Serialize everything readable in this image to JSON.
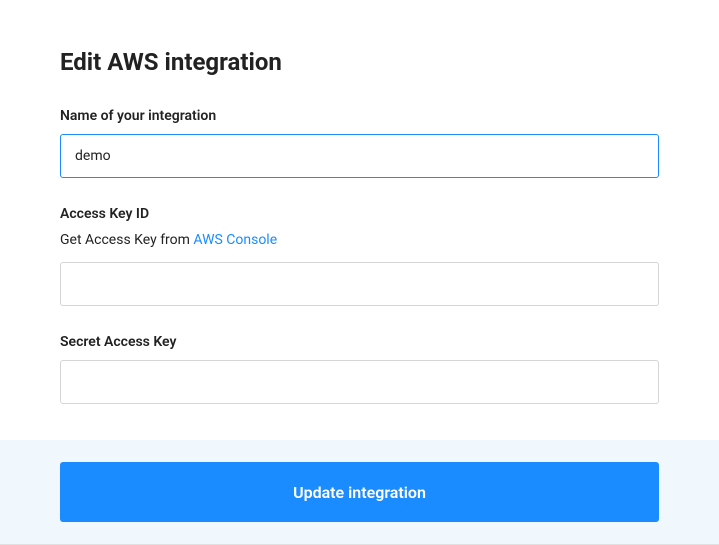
{
  "page": {
    "title": "Edit AWS integration"
  },
  "form": {
    "name": {
      "label": "Name of your integration",
      "value": "demo"
    },
    "accessKeyId": {
      "label": "Access Key ID",
      "help_prefix": "Get Access Key from ",
      "help_link_text": "AWS Console",
      "value": ""
    },
    "secretAccessKey": {
      "label": "Secret Access Key",
      "value": ""
    }
  },
  "footer": {
    "submit_label": "Update integration"
  }
}
